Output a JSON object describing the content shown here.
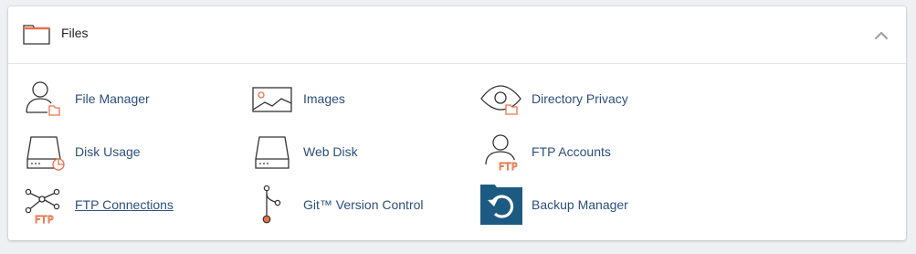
{
  "section": {
    "title": "Files",
    "icon": "folder-icon",
    "collapse_icon": "chevron-up-icon"
  },
  "colors": {
    "link": "#2c4f7c",
    "accent": "#e8734a",
    "icon_dark": "#333333",
    "backup_bg": "#1d5a82"
  },
  "items": [
    {
      "label": "File Manager",
      "icon": "file-manager-icon"
    },
    {
      "label": "Images",
      "icon": "images-icon"
    },
    {
      "label": "Directory Privacy",
      "icon": "directory-privacy-icon"
    },
    {
      "label": "Disk Usage",
      "icon": "disk-usage-icon"
    },
    {
      "label": "Web Disk",
      "icon": "web-disk-icon"
    },
    {
      "label": "FTP Accounts",
      "icon": "ftp-accounts-icon",
      "icon_text": "FTP"
    },
    {
      "label": "FTP Connections",
      "icon": "ftp-connections-icon",
      "icon_text": "FTP"
    },
    {
      "label": "Git™ Version Control",
      "icon": "git-version-control-icon"
    },
    {
      "label": "Backup Manager",
      "icon": "backup-manager-icon"
    }
  ]
}
